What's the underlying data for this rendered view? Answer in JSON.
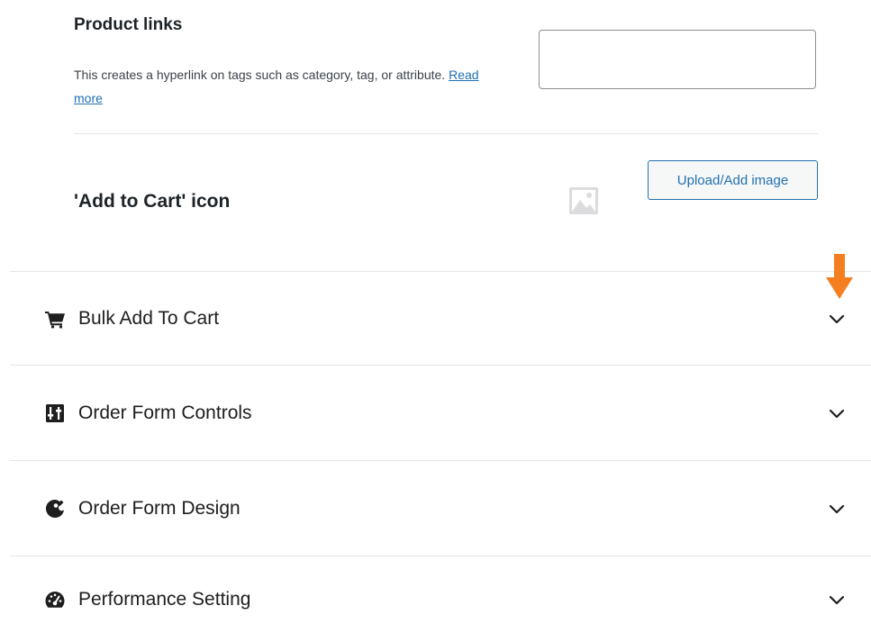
{
  "product_links": {
    "title": "Product links",
    "description": "This creates a hyperlink on tags such as category, tag, or attribute.",
    "read_more": "Read more",
    "input_value": "",
    "input_placeholder": ""
  },
  "add_to_cart_icon": {
    "title": "'Add to Cart' icon",
    "image_icon": "image-placeholder-icon",
    "upload_button": "Upload/Add image"
  },
  "sections": [
    {
      "label": "Bulk Add To Cart",
      "icon": "cart-icon"
    },
    {
      "label": "Order Form Controls",
      "icon": "controls-icon"
    },
    {
      "label": "Order Form Design",
      "icon": "palette-icon"
    },
    {
      "label": "Performance Setting",
      "icon": "dashboard-gauge-icon"
    }
  ],
  "annotation": {
    "icon": "arrow-down-icon",
    "color": "#f57f20"
  },
  "colors": {
    "link": "#2271b1",
    "divider": "#e6e6e6",
    "text": "#1e1e1e"
  }
}
